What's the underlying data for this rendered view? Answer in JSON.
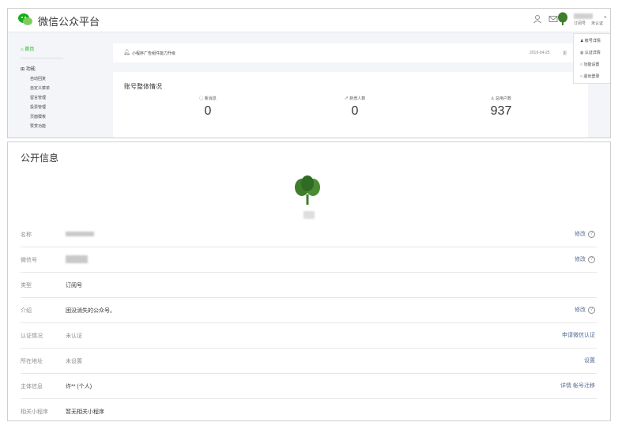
{
  "header": {
    "title": "微信公众平台",
    "user_badges": [
      "订阅号",
      "未认证"
    ]
  },
  "sidebar": {
    "home_label": "首页",
    "function_label": "功能",
    "sub_items": [
      "自动回复",
      "自定义菜单",
      "留言管理",
      "投票管理",
      "页面模板",
      "赞赏功能"
    ]
  },
  "notice": {
    "text": "小程序广告组件能力升级",
    "date": "2019-04-25",
    "more": "更"
  },
  "stats": {
    "title": "账号整体情况",
    "items": [
      {
        "label": "新消息",
        "value": "0"
      },
      {
        "label": "新增人数",
        "value": "0"
      },
      {
        "label": "总用户数",
        "value": "937"
      }
    ]
  },
  "dropdown": {
    "items": [
      "帐号详情",
      "认证详情",
      "功能设置",
      "退出登录"
    ]
  },
  "info": {
    "title": "公开信息",
    "rows": [
      {
        "label": "名称",
        "value": "",
        "action": "修改"
      },
      {
        "label": "微信号",
        "value": "",
        "action": "修改"
      },
      {
        "label": "类型",
        "value": "订阅号",
        "action": ""
      },
      {
        "label": "介绍",
        "value": "困没消失的公众号。",
        "action": "修改"
      },
      {
        "label": "认证情况",
        "value": "未认证",
        "action": "申请微信认证"
      },
      {
        "label": "所在地址",
        "value": "未设置",
        "action": "设置"
      },
      {
        "label": "主体信息",
        "value": "许** (个人)",
        "action": "详情  帐号迁移"
      },
      {
        "label": "相关小程序",
        "value": "暂无相关小程序",
        "action": ""
      }
    ]
  },
  "colors": {
    "brand_green": "#1aad19",
    "link_blue": "#576b95",
    "avatar_green": "#3f7d2c"
  }
}
